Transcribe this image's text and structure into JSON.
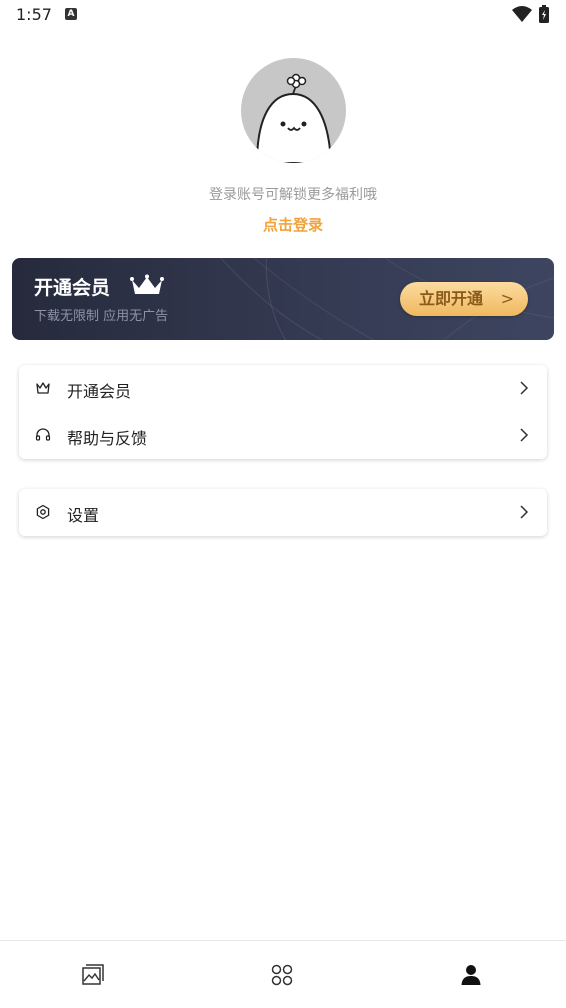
{
  "status_bar": {
    "time": "1:57",
    "notification_letter": "A",
    "icons": [
      "wifi-icon",
      "battery-icon"
    ]
  },
  "profile": {
    "avatar_icon": "avatar-mascot-icon",
    "login_hint": "登录账号可解锁更多福利哦",
    "login_link": "点击登录",
    "login_link_color": "#f2a33a"
  },
  "vip_banner": {
    "title": "开通会员",
    "subtitle": "下载无限制 应用无广告",
    "button_label": "立即开通",
    "button_chevron": ">",
    "crown_icon": "crown-icon",
    "accent_color": "#f0b85e"
  },
  "menu": {
    "group1": [
      {
        "icon": "crown-outline-icon",
        "label": "开通会员"
      },
      {
        "icon": "headset-icon",
        "label": "帮助与反馈"
      }
    ],
    "group2": [
      {
        "icon": "settings-icon",
        "label": "设置"
      }
    ]
  },
  "bottom_nav": {
    "items": [
      {
        "icon": "gallery-icon",
        "active": false
      },
      {
        "icon": "apps-icon",
        "active": false
      },
      {
        "icon": "profile-icon",
        "active": true
      }
    ]
  }
}
